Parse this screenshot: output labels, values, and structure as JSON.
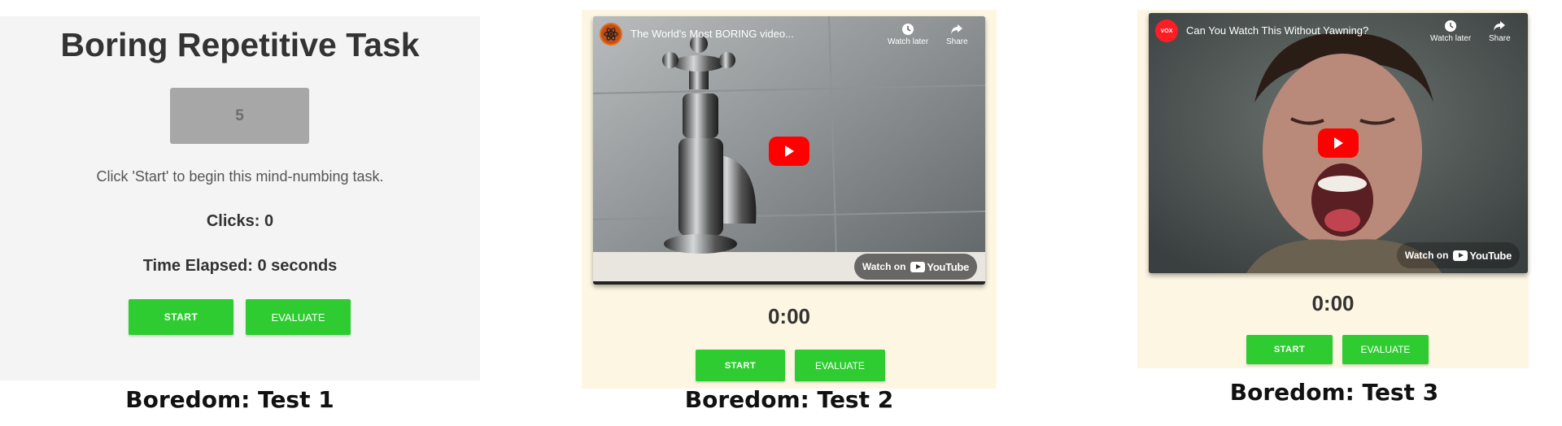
{
  "panel1": {
    "title": "Boring Repetitive Task",
    "counter_display": "5",
    "instruction": "Click 'Start' to begin this mind-numbing task.",
    "clicks_text": "Clicks: 0",
    "time_text": "Time Elapsed: 0 seconds",
    "start_label": "START",
    "evaluate_label": "EVALUATE",
    "caption": "Boredom: Test 1"
  },
  "panel2": {
    "video_title": "The World's Most BORING video...",
    "watch_later": "Watch later",
    "share": "Share",
    "watch_on": "Watch on",
    "youtube": "YouTube",
    "timer": "0:00",
    "start_label": "START",
    "evaluate_label": "EVALUATE",
    "caption": "Boredom: Test 2"
  },
  "panel3": {
    "video_title": "Can You Watch This Without Yawning?",
    "channel_badge": "VOX",
    "watch_later": "Watch later",
    "share": "Share",
    "watch_on": "Watch on",
    "youtube": "YouTube",
    "timer": "0:00",
    "start_label": "START",
    "evaluate_label": "EVALUATE",
    "caption": "Boredom: Test 3"
  },
  "colors": {
    "button_green": "#2ecc31",
    "panel1_bg": "#f4f4f4",
    "panel_cream_bg": "#fdf6e3",
    "counter_box": "#a7a7a7",
    "youtube_red": "#ff0000"
  },
  "icons": {
    "watch_later": "clock-icon",
    "share": "share-arrow-icon",
    "play": "play-icon",
    "youtube": "youtube-logo-icon"
  }
}
